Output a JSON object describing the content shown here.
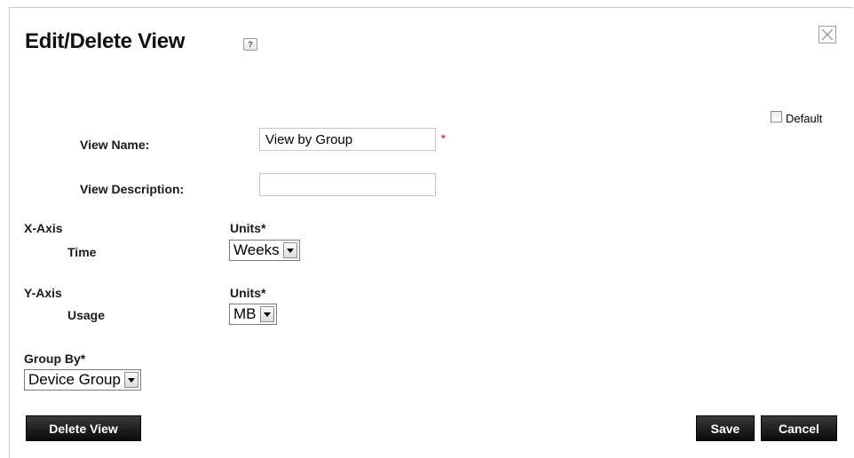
{
  "dialog": {
    "title": "Edit/Delete View",
    "help_icon": "?"
  },
  "default_checkbox": {
    "label": "Default",
    "checked": false
  },
  "form": {
    "view_name_label": "View Name:",
    "view_name_value": "View by Group",
    "required_mark": "*",
    "view_description_label": "View Description:",
    "view_description_value": "",
    "x_axis": {
      "label": "X-Axis",
      "sub_label": "Time",
      "units_label": "Units*",
      "units_value": "Weeks"
    },
    "y_axis": {
      "label": "Y-Axis",
      "sub_label": "Usage",
      "units_label": "Units*",
      "units_value": "MB"
    },
    "group_by": {
      "label": "Group By*",
      "value": "Device Group"
    }
  },
  "buttons": {
    "delete": "Delete View",
    "save": "Save",
    "cancel": "Cancel"
  },
  "colors": {
    "button_bg": "#111111",
    "required": "#e03030"
  }
}
